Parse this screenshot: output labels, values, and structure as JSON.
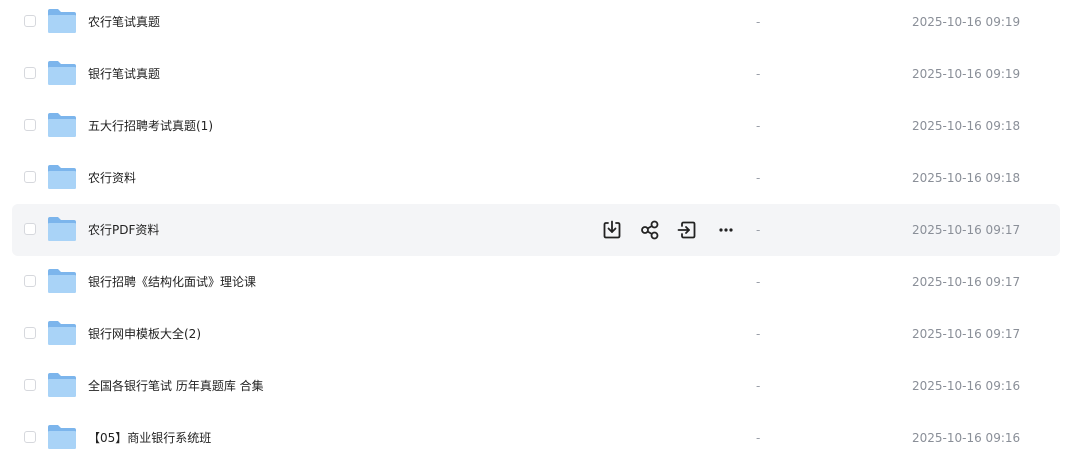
{
  "files": [
    {
      "name": "农行笔试真题",
      "size": "-",
      "date": "2025-10-16 09:19"
    },
    {
      "name": "银行笔试真题",
      "size": "-",
      "date": "2025-10-16 09:19"
    },
    {
      "name": "五大行招聘考试真题(1)",
      "size": "-",
      "date": "2025-10-16 09:18"
    },
    {
      "name": "农行资料",
      "size": "-",
      "date": "2025-10-16 09:18"
    },
    {
      "name": "农行PDF资料",
      "size": "-",
      "date": "2025-10-16 09:17"
    },
    {
      "name": "银行招聘《结构化面试》理论课",
      "size": "-",
      "date": "2025-10-16 09:17"
    },
    {
      "name": "银行网申模板大全(2)",
      "size": "-",
      "date": "2025-10-16 09:17"
    },
    {
      "name": "全国各银行笔试 历年真题库 合集",
      "size": "-",
      "date": "2025-10-16 09:16"
    },
    {
      "name": "【05】商业银行系统班",
      "size": "-",
      "date": "2025-10-16 09:16"
    }
  ],
  "hovered_row": 4,
  "row_actions": [
    "download-icon",
    "share-icon",
    "move-icon",
    "more-icon"
  ],
  "colors": {
    "folder_back": "#7cb5ec",
    "folder_front": "#a9d3f7",
    "hover_bg": "#f4f5f7",
    "text": "#222222",
    "muted": "#8a8f98"
  }
}
